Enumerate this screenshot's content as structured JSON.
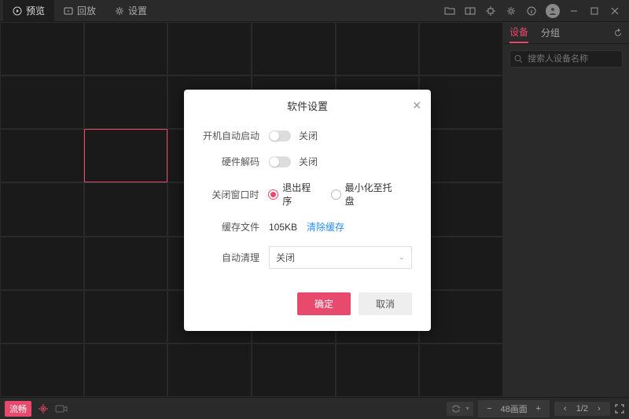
{
  "topnav": {
    "preview": "预览",
    "playback": "回放",
    "settings": "设置"
  },
  "rightpanel": {
    "tab_device": "设备",
    "tab_group": "分组",
    "search_placeholder": "搜索人设备名称"
  },
  "bottombar": {
    "mode": "流畅",
    "grid_label": "48画面",
    "pager": "1/2"
  },
  "dialog": {
    "title": "软件设置",
    "rows": {
      "autostart_label": "开机自动启动",
      "autostart_state": "关闭",
      "hwdecode_label": "硬件解码",
      "hwdecode_state": "关闭",
      "closewin_label": "关闭窗口时",
      "closewin_opt1": "退出程序",
      "closewin_opt2": "最小化至托盘",
      "cache_label": "缓存文件",
      "cache_value": "105KB",
      "cache_clear": "清除缓存",
      "autoclear_label": "自动清理",
      "autoclear_value": "关闭"
    },
    "ok": "确定",
    "cancel": "取消"
  }
}
